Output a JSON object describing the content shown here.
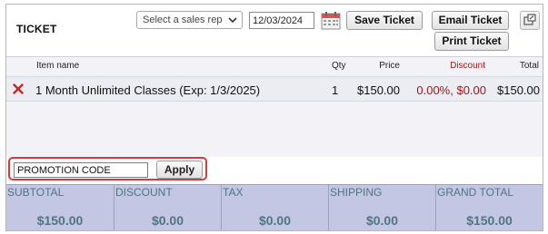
{
  "header": {
    "title": "TICKET",
    "sales_rep_placeholder": "Select a sales rep",
    "date": "12/03/2024",
    "save_label": "Save Ticket",
    "email_label": "Email Ticket",
    "print_label": "Print Ticket",
    "icons": {
      "calendar": "calendar-icon",
      "popout": "popout-icon",
      "dropdown": "chevron-down-icon"
    }
  },
  "items": {
    "columns": {
      "name": "Item name",
      "qty": "Qty",
      "price": "Price",
      "discount": "Discount",
      "total": "Total"
    },
    "rows": [
      {
        "name": "1 Month Unlimited Classes (Exp: 1/3/2025)",
        "qty": "1",
        "price": "$150.00",
        "discount": "0.00%, $0.00",
        "total": "$150.00"
      }
    ]
  },
  "promo": {
    "value": "PROMOTION CODE",
    "apply_label": "Apply"
  },
  "totals": [
    {
      "label": "SUBTOTAL",
      "value": "$150.00"
    },
    {
      "label": "DISCOUNT",
      "value": "$0.00"
    },
    {
      "label": "TAX",
      "value": "$0.00"
    },
    {
      "label": "SHIPPING",
      "value": "$0.00"
    },
    {
      "label": "GRAND TOTAL",
      "value": "$150.00"
    }
  ],
  "colors": {
    "discount_red": "#a31515",
    "totals_bg": "#c3c7e3",
    "totals_text": "#4f7580",
    "promo_highlight": "#d63a3a",
    "items_bg": "#f2f2f7"
  }
}
